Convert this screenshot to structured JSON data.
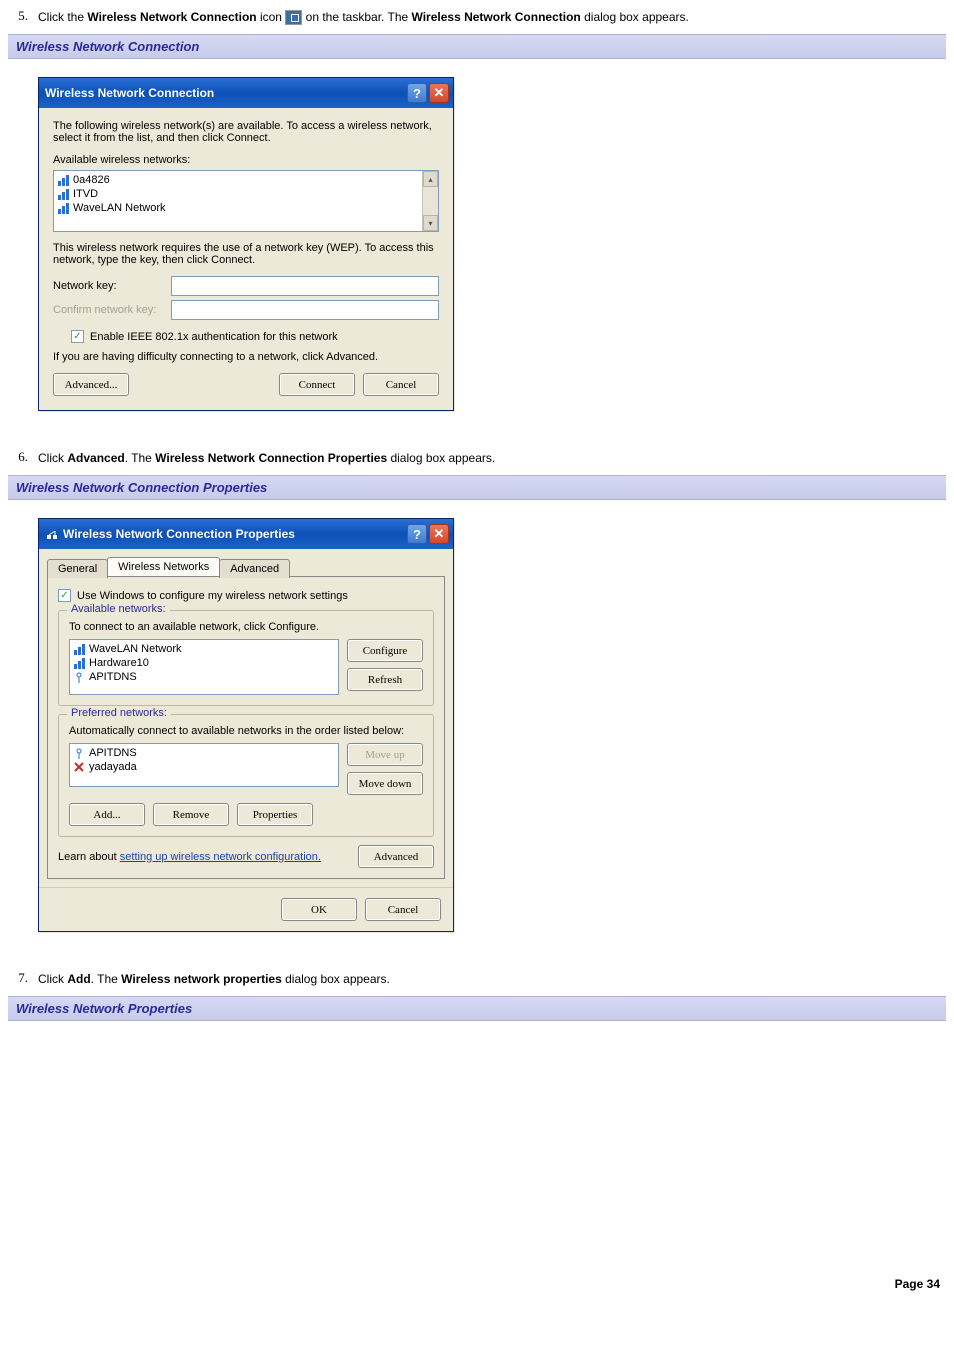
{
  "step5": {
    "num": "5.",
    "text_a": "Click the ",
    "bold_a": "Wireless Network Connection",
    "text_b": " icon ",
    "text_c": " on the taskbar. The ",
    "bold_b": "Wireless Network Connection",
    "text_d": " dialog box appears."
  },
  "caption1": "Wireless Network Connection",
  "dlg1": {
    "title": "Wireless Network Connection",
    "intro": "The following wireless network(s) are available. To access a wireless network, select it from the list, and then click Connect.",
    "avail_label": "Available wireless networks:",
    "networks": [
      "0a4826",
      "ITVD",
      "WaveLAN Network"
    ],
    "wep_text": "This wireless network requires the use of a network key (WEP). To access this network, type the key, then click Connect.",
    "key_label": "Network key:",
    "confirm_label": "Confirm network key:",
    "chk_label": "Enable IEEE 802.1x authentication for this network",
    "diff_text": "If you are having difficulty connecting to a network, click Advanced.",
    "btn_advanced": "Advanced...",
    "btn_connect": "Connect",
    "btn_cancel": "Cancel"
  },
  "step6": {
    "num": "6.",
    "text_a": "Click ",
    "bold_a": "Advanced",
    "text_b": ". The ",
    "bold_b": "Wireless Network Connection Properties",
    "text_c": " dialog box appears."
  },
  "caption2": "Wireless Network Connection Properties",
  "dlg2": {
    "title": "Wireless Network Connection Properties",
    "tabs": {
      "general": "General",
      "wireless": "Wireless Networks",
      "advanced": "Advanced"
    },
    "chk_use": "Use Windows to configure my wireless network settings",
    "grp_avail": "Available networks:",
    "avail_text": "To connect to an available network, click Configure.",
    "avail_items": [
      "WaveLAN Network",
      "Hardware10",
      "APITDNS"
    ],
    "btn_configure": "Configure",
    "btn_refresh": "Refresh",
    "grp_pref": "Preferred networks:",
    "pref_text": "Automatically connect to available networks in the order listed below:",
    "pref_items": [
      "APITDNS",
      "yadayada"
    ],
    "btn_moveup": "Move up",
    "btn_movedown": "Move down",
    "btn_add": "Add...",
    "btn_remove": "Remove",
    "btn_properties": "Properties",
    "learn_a": "Learn about ",
    "learn_link": "setting up wireless network configuration.",
    "btn_advanced": "Advanced",
    "btn_ok": "OK",
    "btn_cancel": "Cancel"
  },
  "step7": {
    "num": "7.",
    "text_a": "Click ",
    "bold_a": "Add",
    "text_b": ". The ",
    "bold_b": "Wireless network properties",
    "text_c": " dialog box appears."
  },
  "caption3": "Wireless Network Properties",
  "page_num": "Page 34"
}
